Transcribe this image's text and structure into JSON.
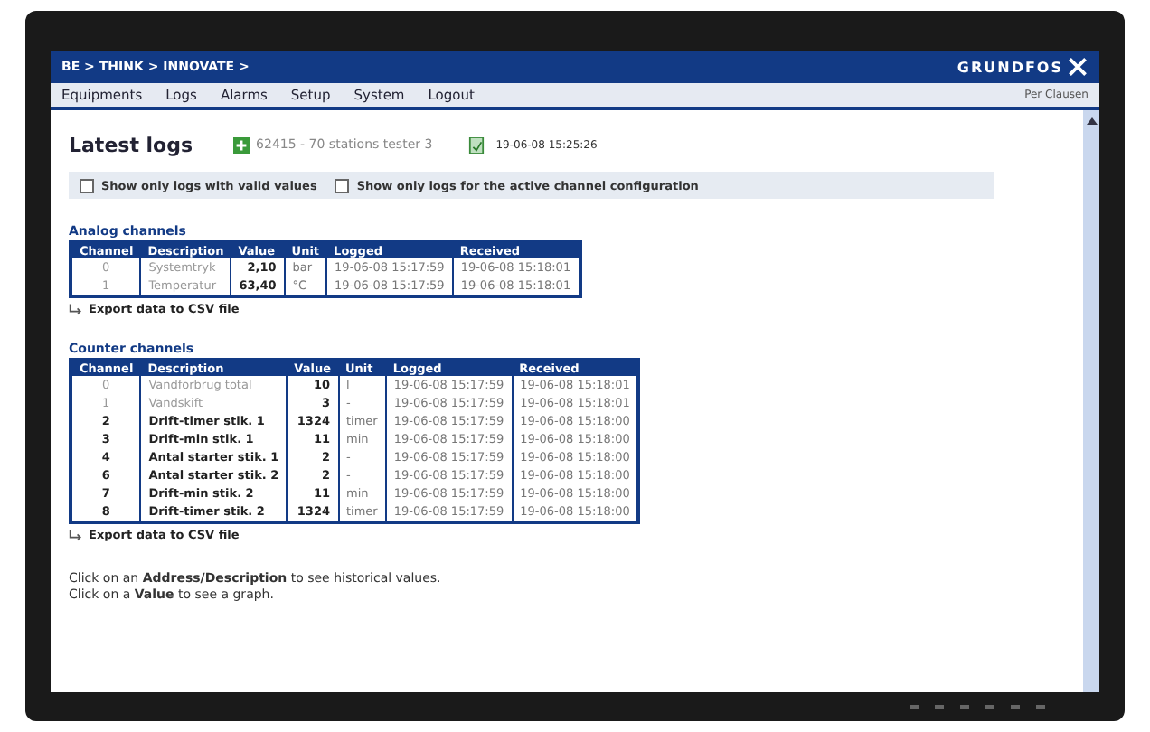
{
  "header": {
    "slogan": "BE > THINK > INNOVATE >",
    "logo": "GRUNDFOS"
  },
  "menu": {
    "items": [
      "Equipments",
      "Logs",
      "Alarms",
      "Setup",
      "System",
      "Logout"
    ],
    "user": "Per Clausen"
  },
  "page": {
    "title": "Latest logs",
    "station": "62415 - 70 stations tester 3",
    "timestamp": "19-06-08 15:25:26"
  },
  "filters": [
    {
      "label": "Show only logs with valid values",
      "checked": false
    },
    {
      "label": "Show only logs for the active channel configuration",
      "checked": false
    }
  ],
  "analog_channels": {
    "heading": "Analog channels",
    "columns": [
      "Channel",
      "Description",
      "Value",
      "Unit",
      "Logged",
      "Received"
    ],
    "rows": [
      {
        "channel": "0",
        "description": "Systemtryk",
        "value": "2,10",
        "unit": "bar",
        "logged": "19-06-08 15:17:59",
        "received": "19-06-08 15:18:01",
        "inactive": true
      },
      {
        "channel": "1",
        "description": "Temperatur",
        "value": "63,40",
        "unit": "°C",
        "logged": "19-06-08 15:17:59",
        "received": "19-06-08 15:18:01",
        "inactive": true
      }
    ],
    "export": "Export data to CSV file"
  },
  "counter_channels": {
    "heading": "Counter channels",
    "columns": [
      "Channel",
      "Description",
      "Value",
      "Unit",
      "Logged",
      "Received"
    ],
    "rows": [
      {
        "channel": "0",
        "description": "Vandforbrug total",
        "value": "10",
        "unit": "l",
        "logged": "19-06-08 15:17:59",
        "received": "19-06-08 15:18:01",
        "inactive": true
      },
      {
        "channel": "1",
        "description": "Vandskift",
        "value": "3",
        "unit": "-",
        "logged": "19-06-08 15:17:59",
        "received": "19-06-08 15:18:01",
        "inactive": true
      },
      {
        "channel": "2",
        "description": "Drift-timer stik. 1",
        "value": "1324",
        "unit": "timer",
        "logged": "19-06-08 15:17:59",
        "received": "19-06-08 15:18:00",
        "inactive": false
      },
      {
        "channel": "3",
        "description": "Drift-min stik. 1",
        "value": "11",
        "unit": "min",
        "logged": "19-06-08 15:17:59",
        "received": "19-06-08 15:18:00",
        "inactive": false
      },
      {
        "channel": "4",
        "description": "Antal starter stik. 1",
        "value": "2",
        "unit": "-",
        "logged": "19-06-08 15:17:59",
        "received": "19-06-08 15:18:00",
        "inactive": false
      },
      {
        "channel": "6",
        "description": "Antal starter stik. 2",
        "value": "2",
        "unit": "-",
        "logged": "19-06-08 15:17:59",
        "received": "19-06-08 15:18:00",
        "inactive": false
      },
      {
        "channel": "7",
        "description": "Drift-min stik. 2",
        "value": "11",
        "unit": "min",
        "logged": "19-06-08 15:17:59",
        "received": "19-06-08 15:18:00",
        "inactive": false
      },
      {
        "channel": "8",
        "description": "Drift-timer stik. 2",
        "value": "1324",
        "unit": "timer",
        "logged": "19-06-08 15:17:59",
        "received": "19-06-08 15:18:00",
        "inactive": false
      }
    ],
    "export": "Export data to CSV file"
  },
  "hints": [
    "Click on an **Address/Description** to see historical values.",
    "Click on a **Value** to see a graph."
  ]
}
